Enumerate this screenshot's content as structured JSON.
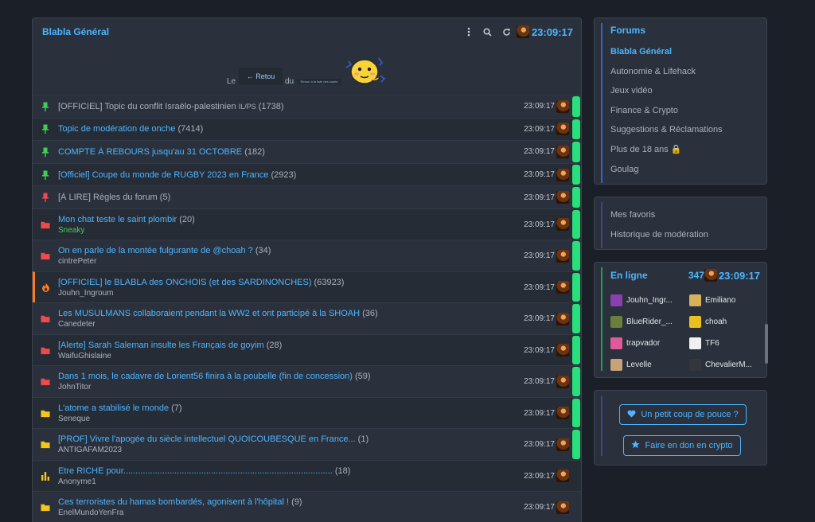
{
  "header": {
    "title": "Blabla Général",
    "time": "23:09:17"
  },
  "banner": {
    "le": "Le",
    "du": "du",
    "retour": "← Retou",
    "retour_small": "Retour à la liste des sujets"
  },
  "topics": [
    {
      "title": "[OFFICIEL] Topic du conflit Israëlo-palestinien",
      "tag": "IL/PS",
      "count": "(1738)",
      "author": "",
      "time": "23:09:17",
      "icon": "pin-icon",
      "icon_color": "#3fcf55",
      "title_style": "grey",
      "bar": true
    },
    {
      "title": "Topic de modération de onche",
      "tag": "",
      "count": "(7414)",
      "author": "",
      "time": "23:09:17",
      "icon": "pin-icon",
      "icon_color": "#3fcf55",
      "title_style": "blue",
      "bar": true
    },
    {
      "title": "COMPTE À REBOURS jusqu'au 31 OCTOBRE",
      "tag": "",
      "count": "(182)",
      "author": "",
      "time": "23:09:17",
      "icon": "pin-icon",
      "icon_color": "#3fcf55",
      "title_style": "blue",
      "bar": true
    },
    {
      "title": "[Officiel] Coupe du monde de RUGBY 2023 en France",
      "tag": "",
      "count": "(2923)",
      "author": "",
      "time": "23:09:17",
      "icon": "pin-icon",
      "icon_color": "#3fcf55",
      "title_style": "blue",
      "bar": true
    },
    {
      "title": "[À LIRE] Règles du forum",
      "tag": "",
      "count": "(5)",
      "author": "",
      "time": "23:09:17",
      "icon": "pin-icon",
      "icon_color": "#f04a4a",
      "title_style": "grey",
      "bar": true
    },
    {
      "title": "Mon chat teste le saint plombir",
      "tag": "",
      "count": "(20)",
      "author": "Sneaky",
      "author_green": true,
      "time": "23:09:17",
      "icon": "folder-icon",
      "icon_color": "#f04a4a",
      "title_style": "blue",
      "bar": true
    },
    {
      "title": "On en parle de la montée fulgurante de @choah ?",
      "tag": "",
      "count": "(34)",
      "author": "cintrePeter",
      "time": "23:09:17",
      "icon": "folder-icon",
      "icon_color": "#f04a4a",
      "title_style": "blue",
      "bar": true
    },
    {
      "title": "[OFFICIEL] le BLABLA des ONCHOIS (et des SARDINONCHES)",
      "tag": "",
      "count": "(63923)",
      "author": "Jouhn_Ingroum",
      "time": "23:09:17",
      "icon": "fire-icon",
      "icon_color": "#ff7a1a",
      "title_style": "blue",
      "bar": true,
      "hot": true
    },
    {
      "title": "Les MUSULMANS collaboraient pendant la WW2 et ont participé à la SHOAH",
      "tag": "",
      "count": "(36)",
      "author": "Canedeter",
      "time": "23:09:17",
      "icon": "folder-icon",
      "icon_color": "#f04a4a",
      "title_style": "blue",
      "bar": true
    },
    {
      "title": "[Alerte] Sarah Saleman insulte les Français de goyim",
      "tag": "",
      "count": "(28)",
      "author": "WaifuGhislaine",
      "time": "23:09:17",
      "icon": "folder-icon",
      "icon_color": "#f04a4a",
      "title_style": "blue",
      "bar": true
    },
    {
      "title": "Dans 1 mois, le cadavre de Lorient56 finira à la poubelle (fin de concession)",
      "tag": "",
      "count": "(59)",
      "author": "JohnTitor",
      "time": "23:09:17",
      "icon": "folder-icon",
      "icon_color": "#f04a4a",
      "title_style": "blue",
      "bar": true
    },
    {
      "title": "L'atome a stabilisé le monde",
      "tag": "",
      "count": "(7)",
      "author": "Seneque",
      "time": "23:09:17",
      "icon": "folder-icon",
      "icon_color": "#f5c518",
      "title_style": "blue",
      "bar": true
    },
    {
      "title": "[PROF] Vivre l'apogée du siècle intellectuel QUOICOUBESQUE en France...",
      "tag": "",
      "count": "(1)",
      "author": "ANTIGAFAM2023",
      "time": "23:09:17",
      "icon": "folder-icon",
      "icon_color": "#f5c518",
      "title_style": "blue",
      "bar": true
    },
    {
      "title": "Etre RICHE pour......................................................................................",
      "tag": "",
      "count": "(18)",
      "author": "Anonyme1",
      "time": "23:09:17",
      "icon": "poll-icon",
      "icon_color": "#f5c518",
      "title_style": "blue",
      "bar": false
    },
    {
      "title": "Ces terroristes du hamas bombardés, agonisent à l'hôpital !",
      "tag": "",
      "count": "(9)",
      "author": "EnelMundoYenFra",
      "time": "23:09:17",
      "icon": "folder-icon",
      "icon_color": "#f5c518",
      "title_style": "blue",
      "bar": false
    }
  ],
  "forums": {
    "title": "Forums",
    "items": [
      {
        "label": "Blabla Général",
        "active": true
      },
      {
        "label": "Autonomie & Lifehack"
      },
      {
        "label": "Jeux vidéo"
      },
      {
        "label": "Finance & Crypto"
      },
      {
        "label": "Suggestions & Réclamations"
      },
      {
        "label": "Plus de 18 ans 🔒"
      },
      {
        "label": "Goulag"
      }
    ]
  },
  "links": {
    "favoris": "Mes favoris",
    "historique": "Historique de modération"
  },
  "online": {
    "title": "En ligne",
    "count": "347",
    "time": "23:09:17",
    "users": [
      {
        "name": "Jouhn_Ingr...",
        "color": "#8a3fb0"
      },
      {
        "name": "Emiliano",
        "color": "#d8b25a"
      },
      {
        "name": "BlueRider_...",
        "color": "#6a7f3c"
      },
      {
        "name": "choah",
        "color": "#e8c020"
      },
      {
        "name": "trapvador",
        "color": "#e05a9a"
      },
      {
        "name": "TF6",
        "color": "#f0f0f0"
      },
      {
        "name": "Levelle",
        "color": "#c9a27a"
      },
      {
        "name": "ChevalierM...",
        "color": "#33363c"
      }
    ]
  },
  "support": {
    "pouce": "Un petit coup de pouce ?",
    "crypto": "Faire en don en crypto"
  },
  "colors": {
    "accent": "#4db5ff",
    "green_bar": "#28e07a",
    "hot": "#ff7a1a"
  }
}
